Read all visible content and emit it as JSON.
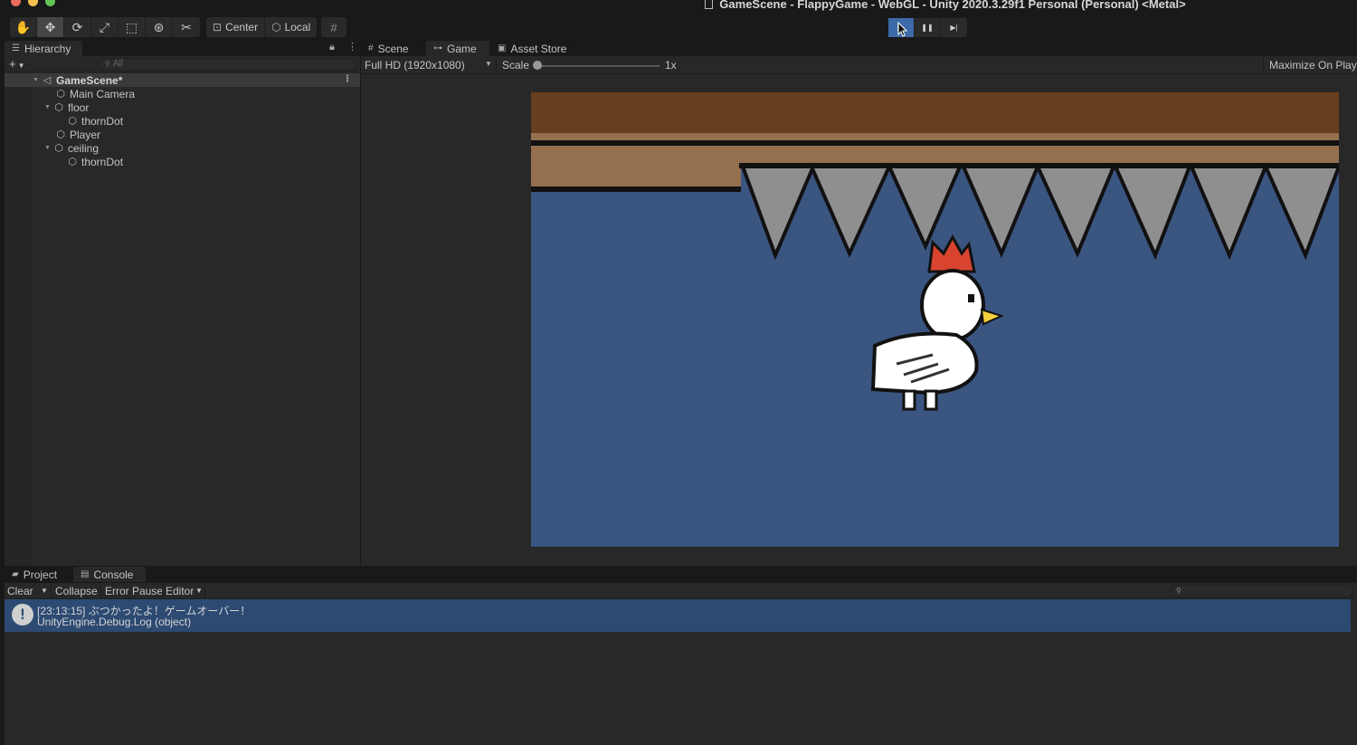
{
  "window": {
    "title": "GameScene - FlappyGame - WebGL - Unity 2020.3.29f1 Personal (Personal) <Metal>"
  },
  "toolbar": {
    "tools": [
      {
        "name": "hand-tool-icon",
        "glyph": "✋"
      },
      {
        "name": "move-tool-icon",
        "glyph": "✥"
      },
      {
        "name": "rotate-tool-icon",
        "glyph": "⟳"
      },
      {
        "name": "scale-tool-icon",
        "glyph": "⤢"
      },
      {
        "name": "rect-tool-icon",
        "glyph": "⬚"
      },
      {
        "name": "transform-tool-icon",
        "glyph": "⊛"
      },
      {
        "name": "custom-tool-icon",
        "glyph": "✂"
      }
    ],
    "pivot_label": "Center",
    "space_label": "Local",
    "grid_glyph": "#"
  },
  "play_controls": {
    "play_glyph": "▶",
    "pause_glyph": "❚❚",
    "step_glyph": "▶|"
  },
  "hierarchy": {
    "tab_label": "Hierarchy",
    "search_placeholder": "All",
    "scene_name": "GameScene*",
    "items": [
      {
        "label": "Main Camera",
        "depth": 1,
        "expandable": false
      },
      {
        "label": "floor",
        "depth": 1,
        "expandable": true
      },
      {
        "label": "thornDot",
        "depth": 2,
        "expandable": false
      },
      {
        "label": "Player",
        "depth": 1,
        "expandable": false
      },
      {
        "label": "ceiling",
        "depth": 1,
        "expandable": true
      },
      {
        "label": "thornDot",
        "depth": 2,
        "expandable": false
      }
    ]
  },
  "game_view": {
    "tabs": [
      "Scene",
      "Game",
      "Asset Store"
    ],
    "selected_tab": "Game",
    "resolution": "Full HD (1920x1080)",
    "scale_label": "Scale",
    "scale_value": "1x",
    "maximize_label": "Maximize On Play"
  },
  "console": {
    "tabs": [
      "Project",
      "Console"
    ],
    "selected_tab": "Console",
    "clear_label": "Clear",
    "collapse_label": "Collapse",
    "error_pause_label": "Error Pause",
    "editor_label": "Editor",
    "log": {
      "line1": "[23:13:15] ぶつかったよ！ゲームオーバー！",
      "line2": "UnityEngine.Debug.Log (object)"
    }
  },
  "colors": {
    "sky": "#3b5581",
    "ceiling_dark": "#673e1e",
    "ceiling_light": "#94704f",
    "spike": "#8f8f8f",
    "crown": "#d9442f",
    "beak": "#f3d13b",
    "log_highlight": "#2c4a72",
    "play_active": "#3d6aa8"
  }
}
